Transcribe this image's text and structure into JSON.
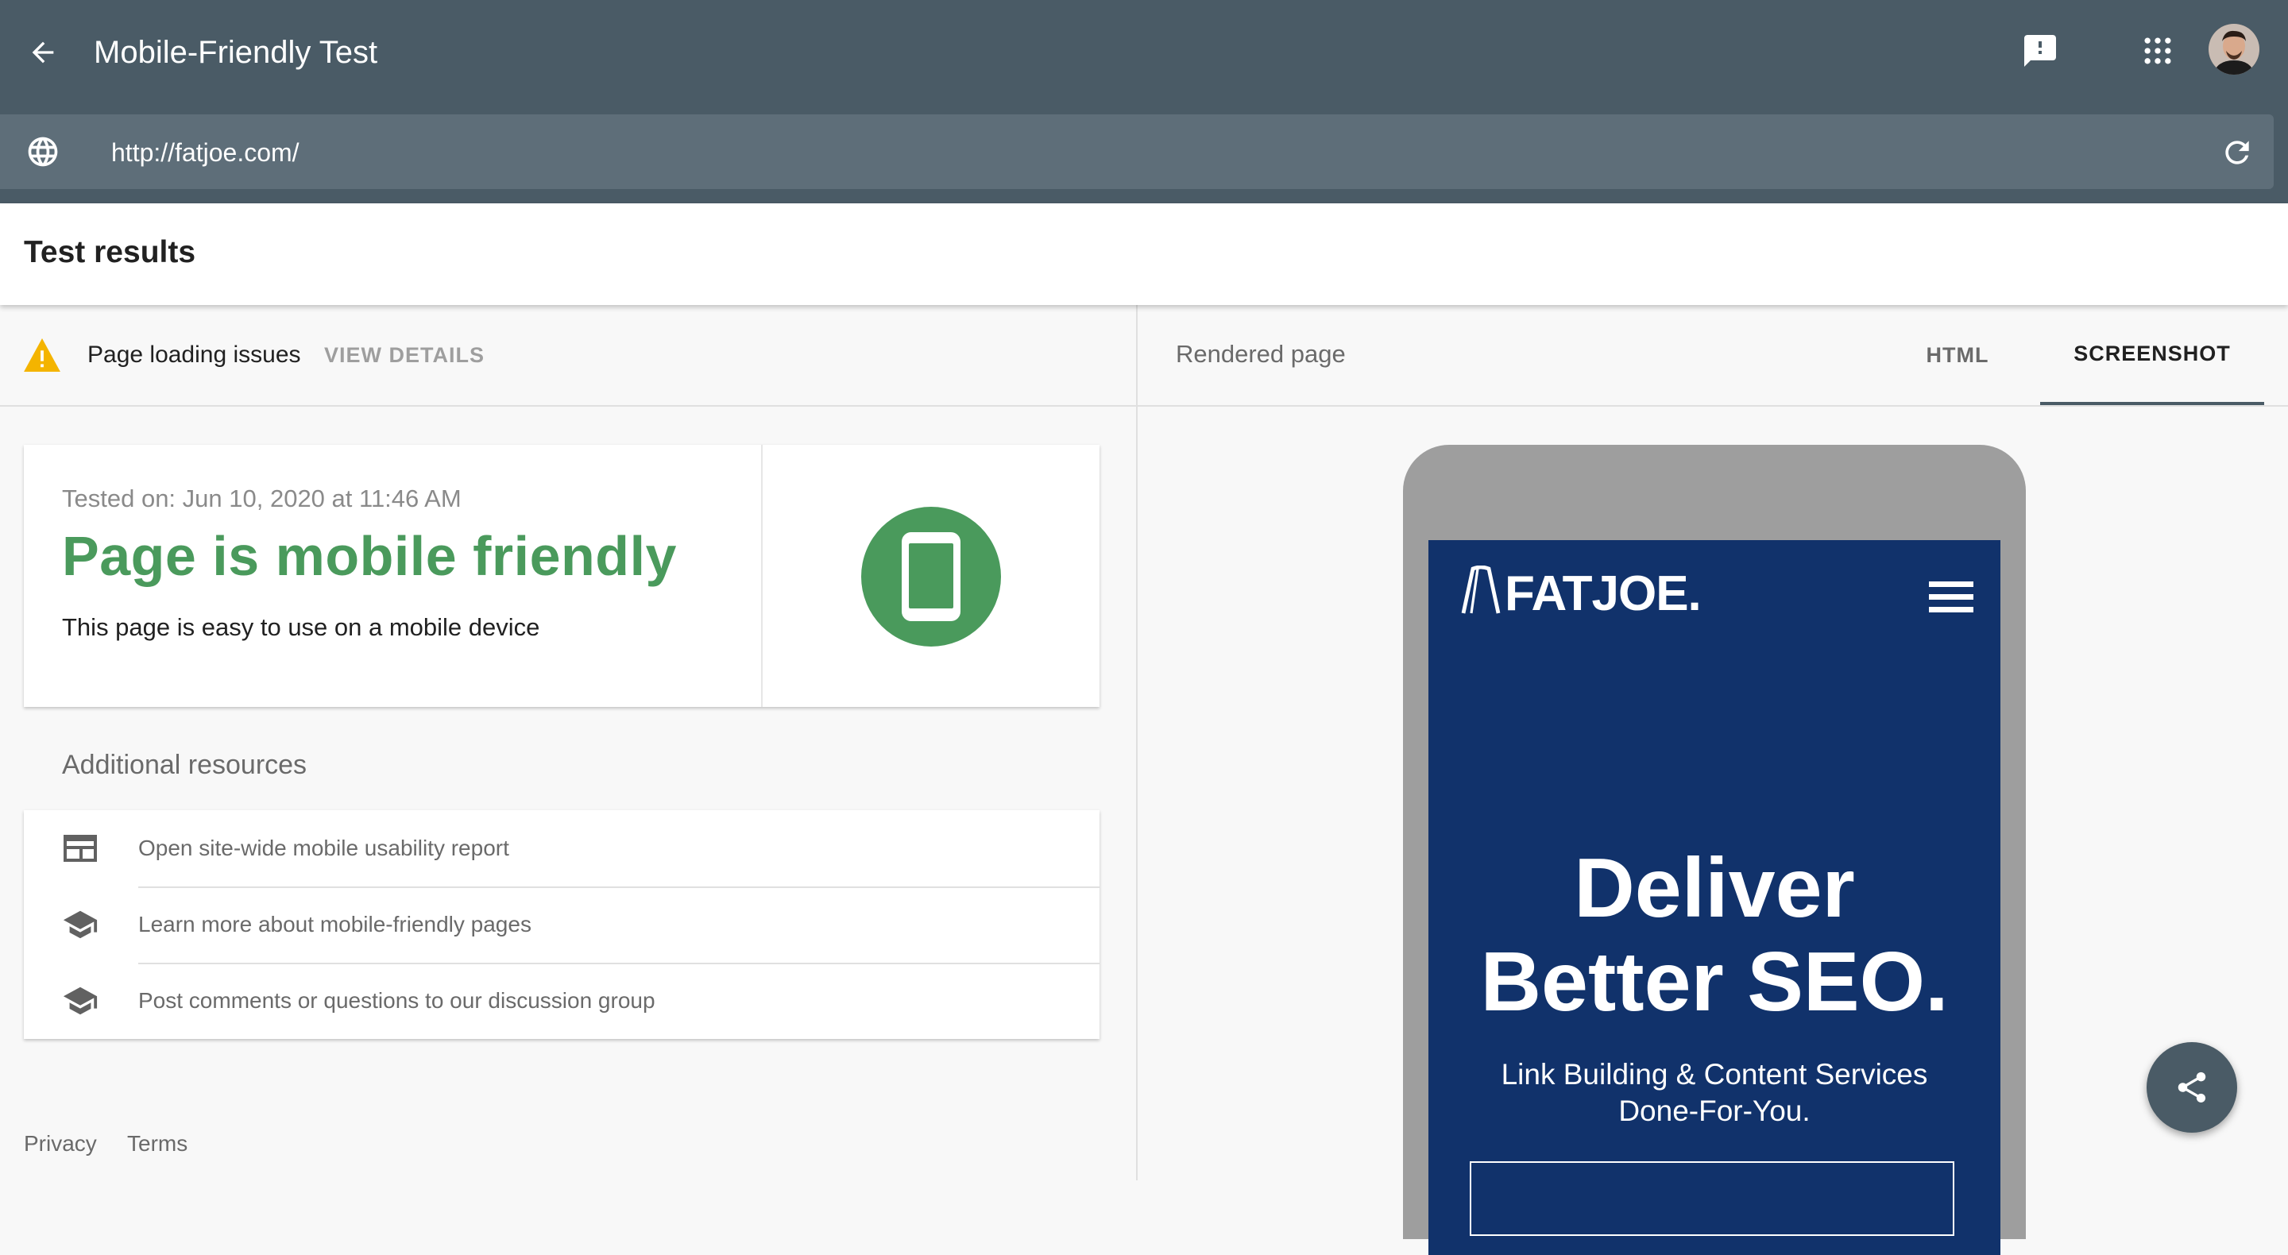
{
  "appbar": {
    "title": "Mobile-Friendly Test",
    "url_value": "http://fatjoe.com/",
    "icons": [
      "arrow-back-icon",
      "feedback-icon",
      "apps-grid-icon",
      "globe-icon",
      "refresh-icon"
    ]
  },
  "results": {
    "title": "Test results"
  },
  "issues": {
    "text": "Page loading issues",
    "action": "VIEW DETAILS"
  },
  "result_card": {
    "tested_on": "Tested on: Jun 10, 2020 at 11:46 AM",
    "verdict": "Page is mobile friendly",
    "subtitle": "This page is easy to use on a mobile device"
  },
  "additional": {
    "title": "Additional resources",
    "items": [
      {
        "label": "Open site-wide mobile usability report",
        "icon": "report-icon"
      },
      {
        "label": "Learn more about mobile-friendly pages",
        "icon": "school-icon"
      },
      {
        "label": "Post comments or questions to our discussion group",
        "icon": "school-icon"
      }
    ]
  },
  "footer": {
    "privacy": "Privacy",
    "terms": "Terms"
  },
  "rendered": {
    "title": "Rendered page",
    "tabs": [
      "HTML",
      "SCREENSHOT"
    ],
    "active_tab": "SCREENSHOT"
  },
  "preview": {
    "logo": "FATJOE.",
    "hero_line1": "Deliver",
    "hero_line2": "Better SEO.",
    "sub_line1": "Link Building & Content Services",
    "sub_line2": "Done-For-You."
  },
  "colors": {
    "appbar": "#4a5b66",
    "urlbar": "#5e6e79",
    "success_green": "#4a9a5c",
    "warning_amber": "#f4b400",
    "site_blue": "#11326b"
  }
}
